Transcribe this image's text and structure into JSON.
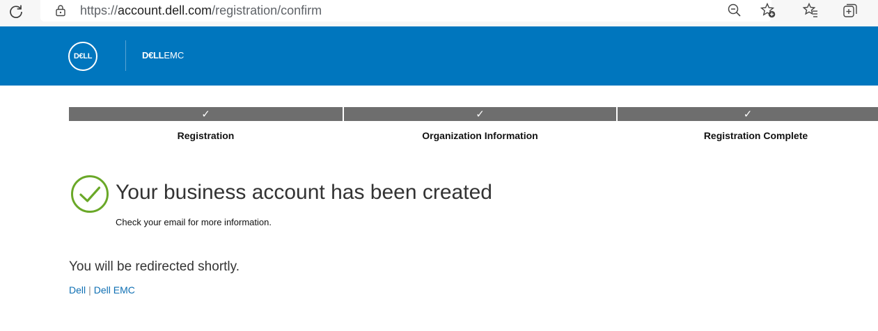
{
  "browser": {
    "url_scheme": "https://",
    "url_domain": "account.dell.com",
    "url_path": "/registration/confirm",
    "icons": [
      "reload-icon",
      "lock-icon",
      "zoom-out-icon",
      "add-favorite-icon",
      "favorites-icon",
      "collections-icon"
    ]
  },
  "header": {
    "logo_text": "D€LL",
    "brand_bold": "D€LL",
    "brand_light": "EMC",
    "background_color": "#0076be"
  },
  "steps": [
    {
      "check": "✓",
      "label": "Registration"
    },
    {
      "check": "✓",
      "label": "Organization Information"
    },
    {
      "check": "✓",
      "label": "Registration Complete"
    }
  ],
  "confirmation": {
    "headline": "Your business account has been created",
    "subtext": "Check your email for more information.",
    "success_color": "#6aa828"
  },
  "redirect_text": "You will be redirected shortly.",
  "footer": {
    "links": [
      "Dell",
      "Dell EMC"
    ],
    "separator": "|"
  }
}
